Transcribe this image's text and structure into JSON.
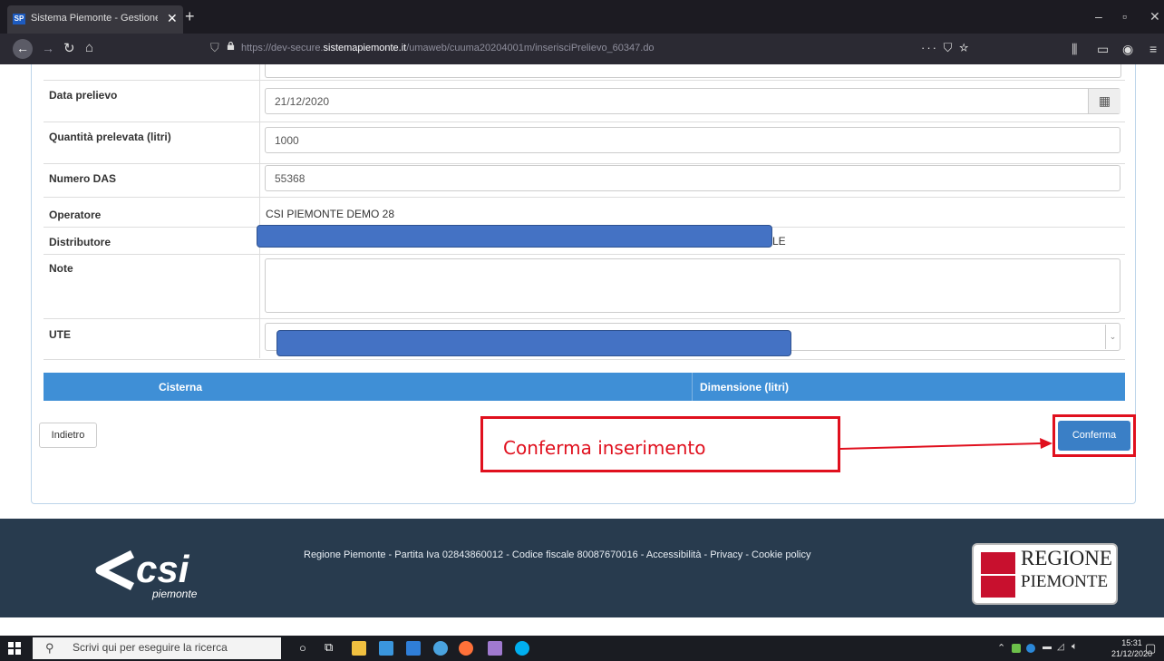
{
  "browser": {
    "tab_title": "Sistema Piemonte - Gestione a",
    "tab_logo": "SP",
    "url_prefix": "https://dev-secure.",
    "url_domain": "sistemapiemonte.it",
    "url_path": "/umaweb/cuuma20204001m/inserisciPrelievo_60347.do"
  },
  "form": {
    "data_prelievo": {
      "label": "Data prelievo",
      "value": "21/12/2020"
    },
    "quantita": {
      "label": "Quantità prelevata (litri)",
      "value": "1000"
    },
    "numero_das": {
      "label": "Numero DAS",
      "value": "55368"
    },
    "operatore": {
      "label": "Operatore",
      "value": "CSI PIEMONTE DEMO 28"
    },
    "distributore": {
      "label": "Distributore",
      "value_tail": "LE"
    },
    "note": {
      "label": "Note",
      "value": ""
    },
    "ute": {
      "label": "UTE"
    }
  },
  "table": {
    "headers": [
      "Cisterna",
      "Dimensione (litri)"
    ]
  },
  "buttons": {
    "back": "Indietro",
    "confirm": "Conferma"
  },
  "annotation": {
    "text": "Conferma inserimento",
    "color": "#e0101e"
  },
  "footer": {
    "text": "Regione Piemonte - Partita Iva 02843860012 - Codice fiscale 80087670016 - Accessibilità - Privacy - Cookie policy",
    "csi_logo": "csi",
    "csi_sub": "piemonte",
    "regione_line1": "REGIONE",
    "regione_line2": "PIEMONTE"
  },
  "taskbar": {
    "search_placeholder": "Scrivi qui per eseguire la ricerca",
    "time": "15:31",
    "date": "21/12/2020"
  },
  "colors": {
    "table_header": "#3f8fd6",
    "confirm_button": "#3a7fc6",
    "footer_bg": "#283b4e",
    "redaction": "#4472c4"
  }
}
